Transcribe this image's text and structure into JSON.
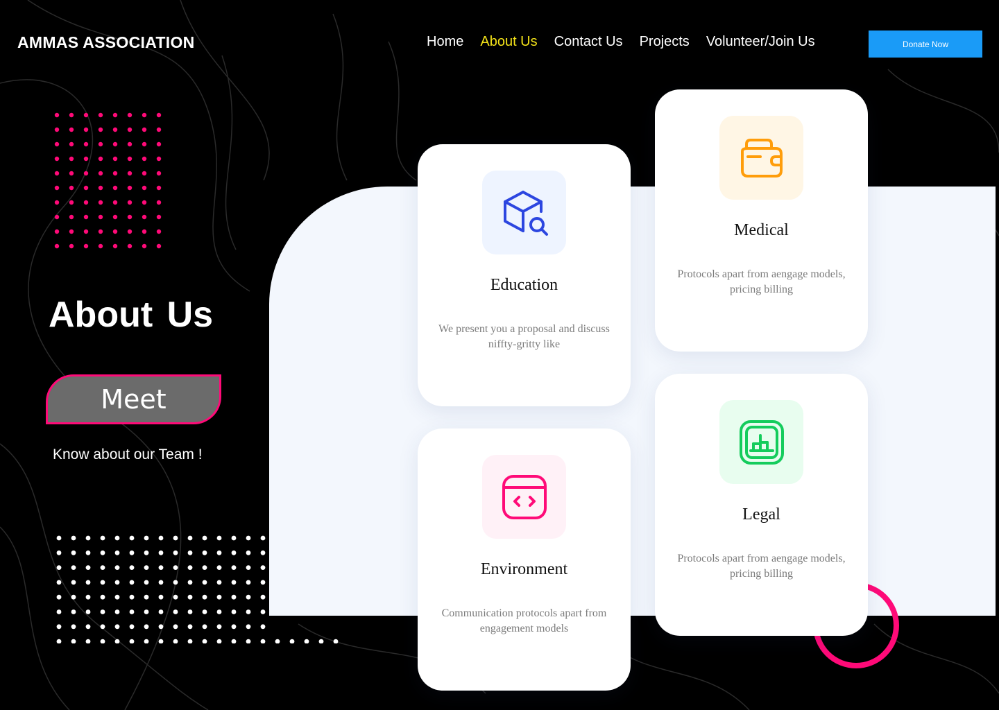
{
  "header": {
    "brand": "AMMAS ASSOCIATION",
    "nav": [
      {
        "label": "Home",
        "active": false
      },
      {
        "label": "About Us",
        "active": true
      },
      {
        "label": "Contact Us",
        "active": false
      },
      {
        "label": "Projects",
        "active": false
      },
      {
        "label": "Volunteer/Join Us",
        "active": false
      }
    ],
    "donate_label": "Donate Now"
  },
  "hero": {
    "title": "About Us",
    "meet_label": "Meet",
    "subtitle": "Know about our Team !"
  },
  "cards": {
    "education": {
      "title": "Education",
      "description": "We present you a proposal and discuss niffty-gritty like",
      "icon": "box-search-icon",
      "icon_color": "#2c46e0",
      "icon_bg": "#eef4ff"
    },
    "environment": {
      "title": "Environment",
      "description": "Communication protocols apart from engagement models",
      "icon": "code-window-icon",
      "icon_color": "#ff0a78",
      "icon_bg": "#fff1f7"
    },
    "medical": {
      "title": "Medical",
      "description": "Protocols apart from aengage models, pricing billing",
      "icon": "wallet-icon",
      "icon_color": "#ff9d0a",
      "icon_bg": "#fff6e5"
    },
    "legal": {
      "title": "Legal",
      "description": "Protocols apart from aengage models, pricing billing",
      "icon": "chart-square-icon",
      "icon_color": "#14cc5c",
      "icon_bg": "#e8fdef"
    }
  },
  "colors": {
    "accent_pink": "#ff0a78",
    "active_nav": "#f5e419",
    "donate_blue": "#1a9bf7",
    "panel_bg": "#f3f7fd"
  }
}
